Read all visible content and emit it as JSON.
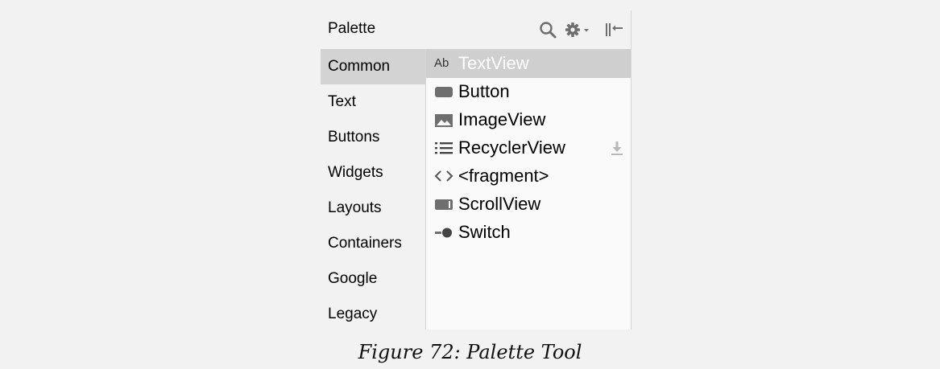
{
  "palette": {
    "title": "Palette",
    "header_icons": [
      "search-icon",
      "gear-icon",
      "collapse-icon"
    ],
    "categories": [
      {
        "label": "Common",
        "selected": true
      },
      {
        "label": "Text",
        "selected": false
      },
      {
        "label": "Buttons",
        "selected": false
      },
      {
        "label": "Widgets",
        "selected": false
      },
      {
        "label": "Layouts",
        "selected": false
      },
      {
        "label": "Containers",
        "selected": false
      },
      {
        "label": "Google",
        "selected": false
      },
      {
        "label": "Legacy",
        "selected": false
      }
    ],
    "widgets": [
      {
        "label": "TextView",
        "icon": "textview-icon",
        "icon_text": "Ab",
        "selected": true
      },
      {
        "label": "Button",
        "icon": "button-icon",
        "selected": false
      },
      {
        "label": "ImageView",
        "icon": "image-icon",
        "selected": false
      },
      {
        "label": "RecyclerView",
        "icon": "list-icon",
        "selected": false,
        "download": true
      },
      {
        "label": "<fragment>",
        "icon": "code-icon",
        "selected": false
      },
      {
        "label": "ScrollView",
        "icon": "scrollview-icon",
        "selected": false
      },
      {
        "label": "Switch",
        "icon": "switch-icon",
        "selected": false
      }
    ]
  },
  "caption": "Figure 72: Palette Tool",
  "colors": {
    "background": "#f2f2f2",
    "selected_category": "#d3d3d3",
    "selected_widget": "#cfcfcf",
    "icon_gray": "#6e6e6e",
    "divider": "#d6d6d6"
  }
}
